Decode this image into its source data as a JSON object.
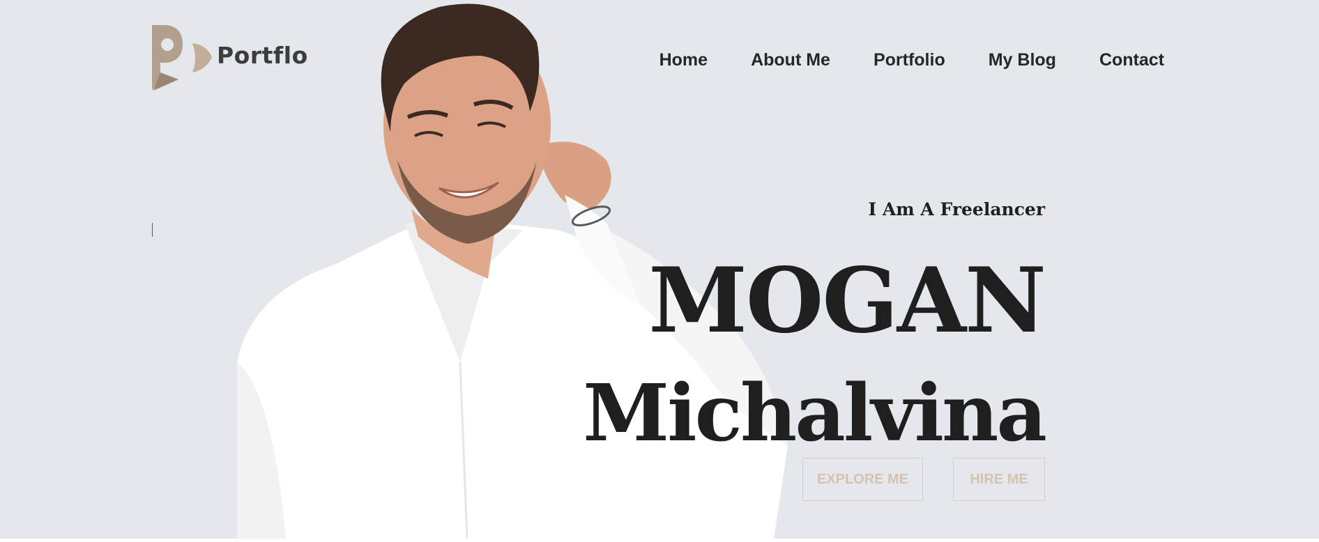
{
  "brand": {
    "name": "Portflo",
    "logo_icon": "p-logo-mark",
    "accent_color": "#b09a86"
  },
  "nav": {
    "items": [
      {
        "label": "Home"
      },
      {
        "label": "About Me"
      },
      {
        "label": "Portfolio"
      },
      {
        "label": "My Blog"
      },
      {
        "label": "Contact"
      }
    ]
  },
  "hero": {
    "tagline": "I Am A Freelancer",
    "first_name": "MOGAN",
    "last_name": "Michalvina",
    "buttons": {
      "explore": "EXPLORE ME",
      "hire": "HIRE ME"
    },
    "background_color": "#e4e8ec",
    "button_color": "#d6c2ad"
  }
}
